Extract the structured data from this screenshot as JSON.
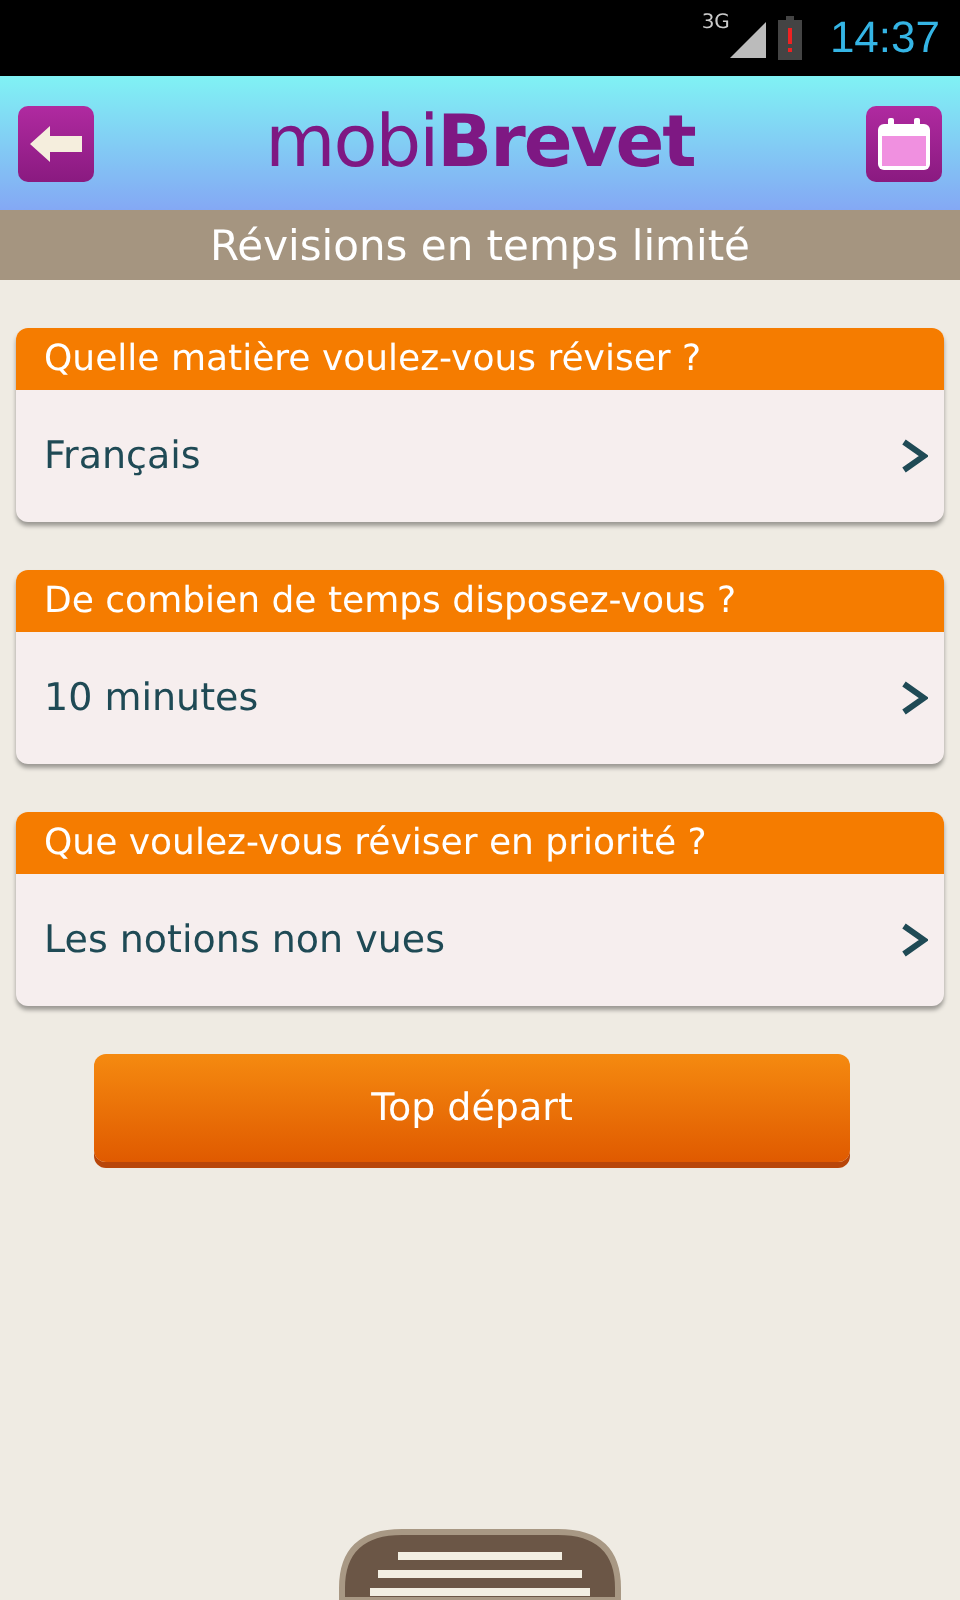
{
  "status_bar": {
    "network": "3G",
    "time": "14:37"
  },
  "header": {
    "logo": "mobi**Brevet**"
  },
  "subtitle": "Révisions en temps limité",
  "questions": [
    {
      "question": "Quelle matière voulez-vous réviser ?",
      "answer": "Français"
    },
    {
      "question": "De combien de temps disposez-vous ?",
      "answer": "10 minutes"
    },
    {
      "question": "Que voulez-vous réviser en priorité ?",
      "answer": "Les notions non vues"
    }
  ],
  "start_button": "Top départ"
}
